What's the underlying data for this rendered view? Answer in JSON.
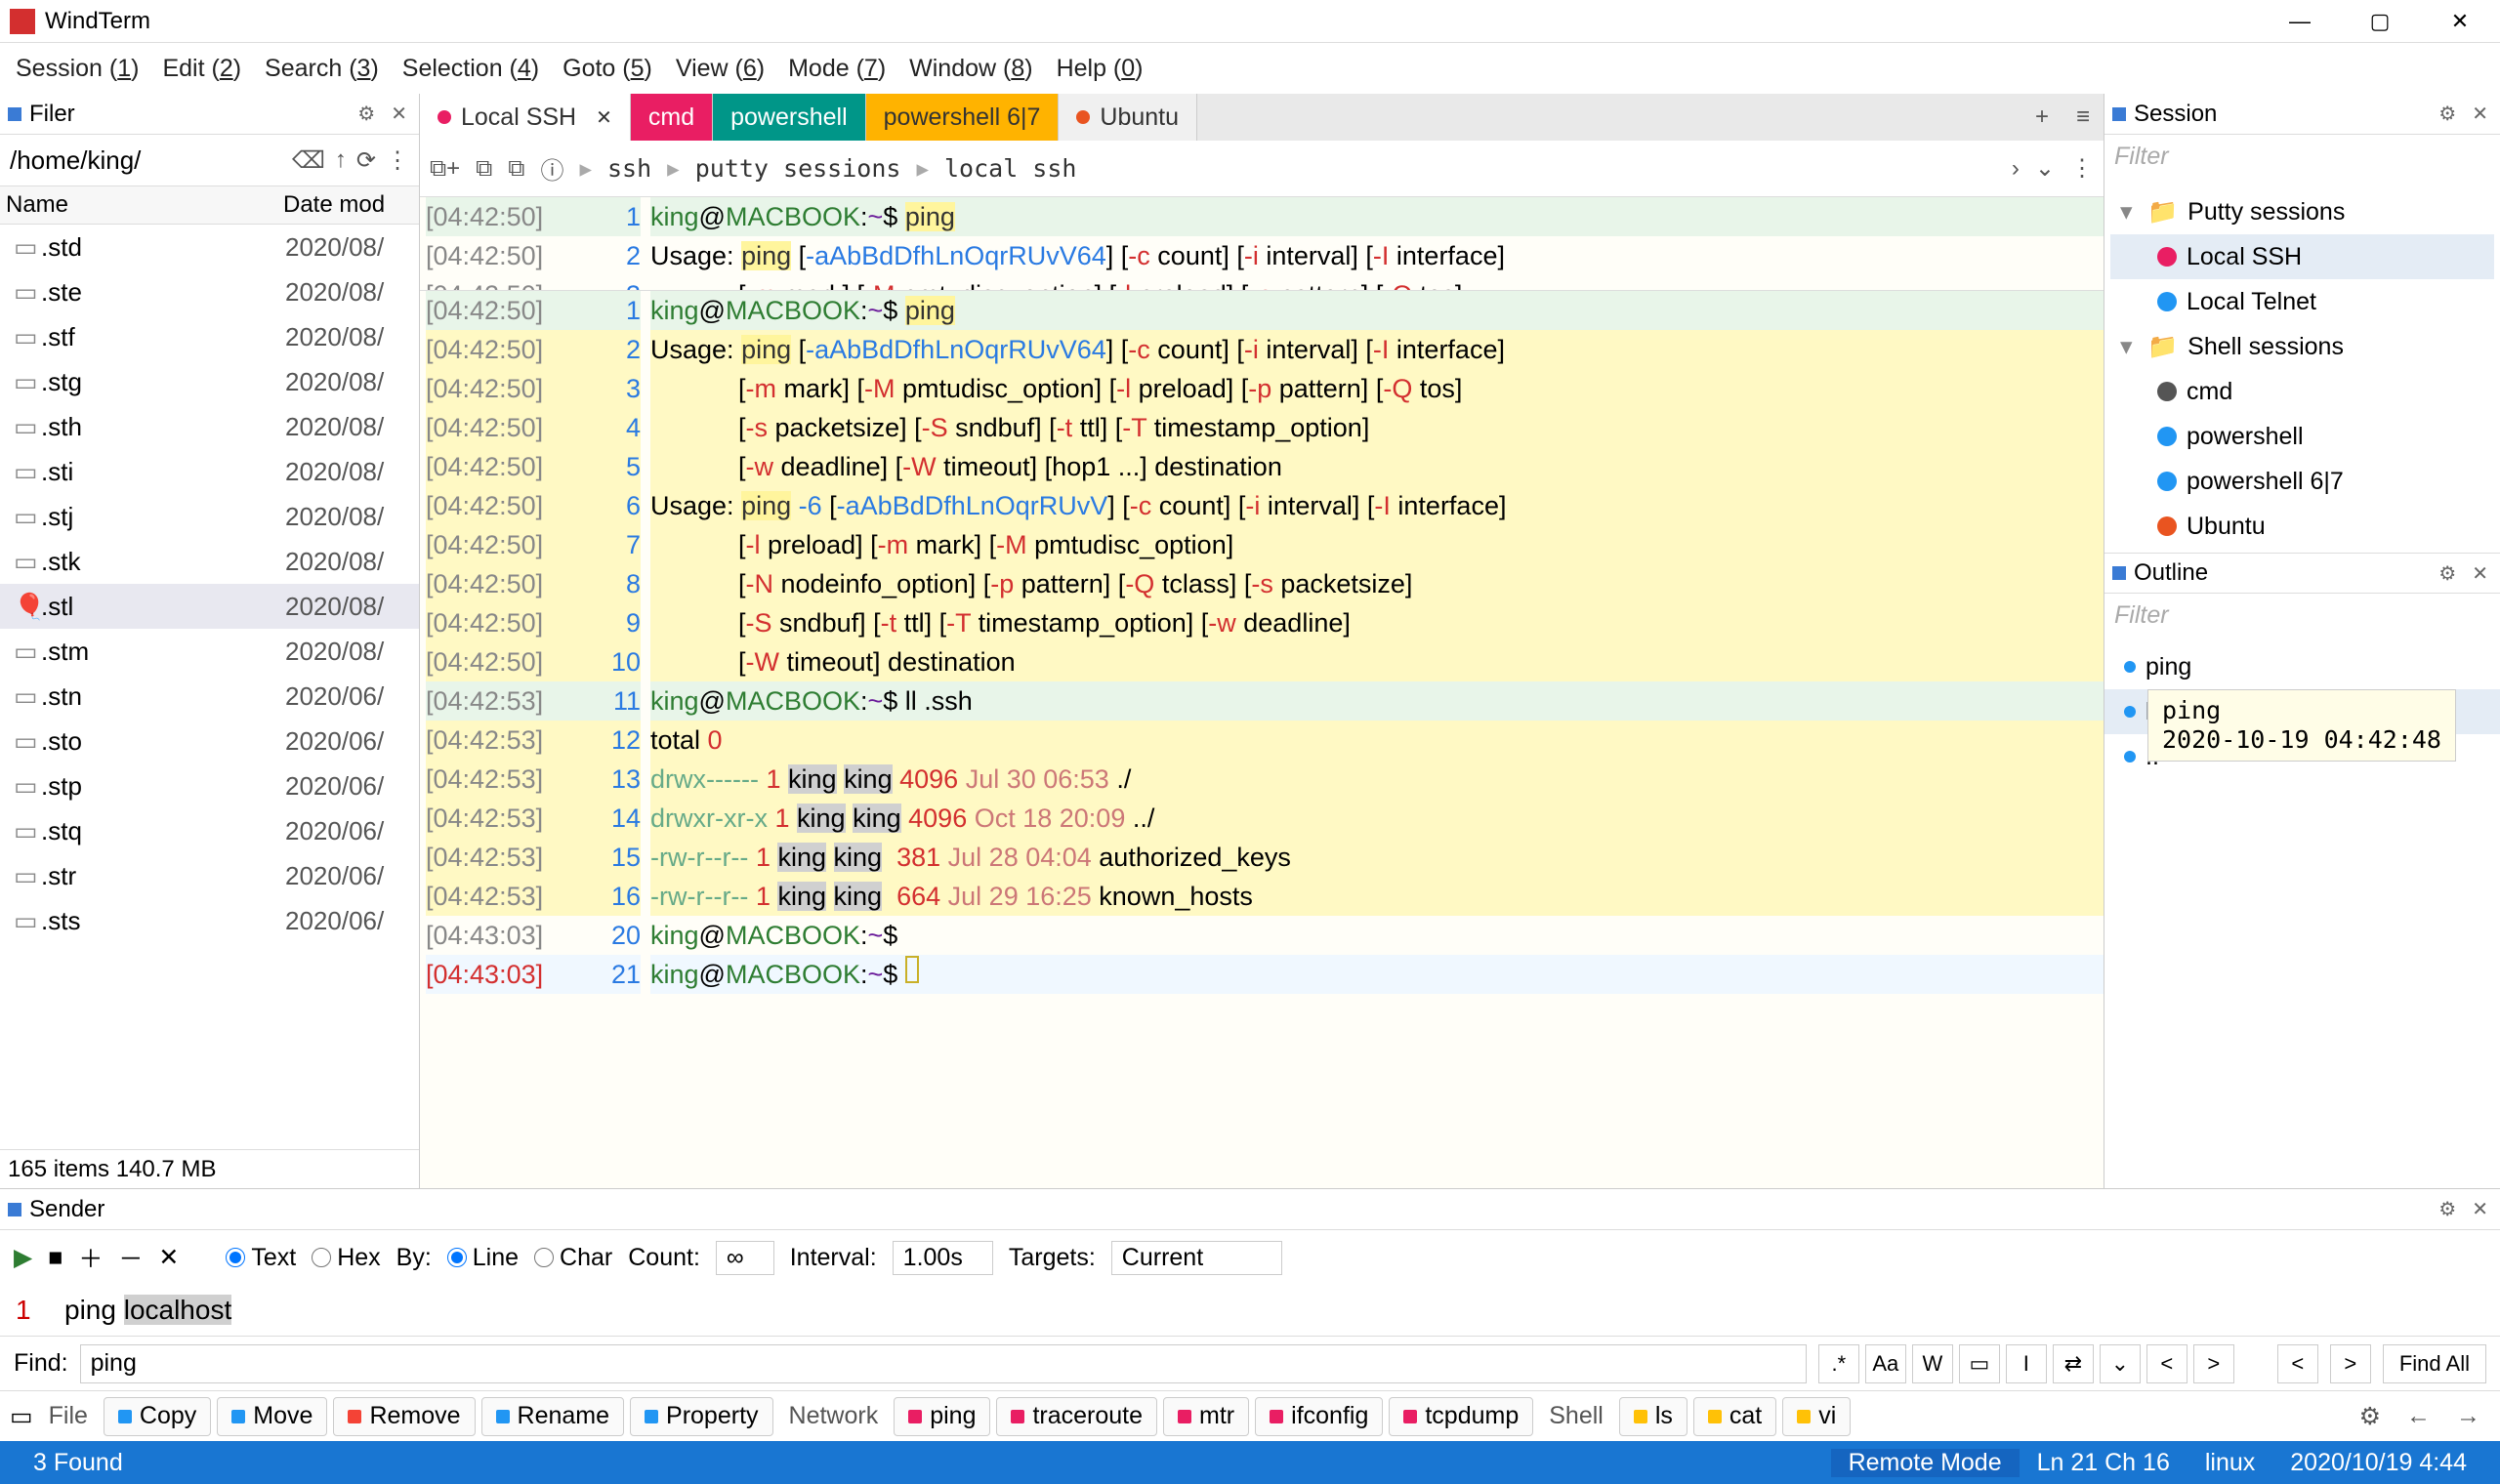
{
  "app": {
    "title": "WindTerm"
  },
  "window": {
    "min": "—",
    "max": "▢",
    "close": "✕"
  },
  "menu": [
    {
      "l": "Session",
      "k": "1"
    },
    {
      "l": "Edit",
      "k": "2"
    },
    {
      "l": "Search",
      "k": "3"
    },
    {
      "l": "Selection",
      "k": "4"
    },
    {
      "l": "Goto",
      "k": "5"
    },
    {
      "l": "View",
      "k": "6"
    },
    {
      "l": "Mode",
      "k": "7"
    },
    {
      "l": "Window",
      "k": "8"
    },
    {
      "l": "Help",
      "k": "0"
    }
  ],
  "filer": {
    "title": "Filer",
    "path": "/home/king/",
    "cols": {
      "name": "Name",
      "date": "Date mod"
    },
    "rows": [
      {
        "ic": "▭",
        "n": ".std",
        "d": "2020/08/"
      },
      {
        "ic": "▭",
        "n": ".ste",
        "d": "2020/08/"
      },
      {
        "ic": "▭",
        "n": ".stf",
        "d": "2020/08/"
      },
      {
        "ic": "▭",
        "n": ".stg",
        "d": "2020/08/"
      },
      {
        "ic": "▭",
        "n": ".sth",
        "d": "2020/08/"
      },
      {
        "ic": "▭",
        "n": ".sti",
        "d": "2020/08/"
      },
      {
        "ic": "▭",
        "n": ".stj",
        "d": "2020/08/"
      },
      {
        "ic": "▭",
        "n": ".stk",
        "d": "2020/08/"
      },
      {
        "ic": "🎈",
        "n": ".stl",
        "d": "2020/08/",
        "sel": true
      },
      {
        "ic": "▭",
        "n": ".stm",
        "d": "2020/08/"
      },
      {
        "ic": "▭",
        "n": ".stn",
        "d": "2020/06/"
      },
      {
        "ic": "▭",
        "n": ".sto",
        "d": "2020/06/"
      },
      {
        "ic": "▭",
        "n": ".stp",
        "d": "2020/06/"
      },
      {
        "ic": "▭",
        "n": ".stq",
        "d": "2020/06/"
      },
      {
        "ic": "▭",
        "n": ".str",
        "d": "2020/06/"
      },
      {
        "ic": "▭",
        "n": ".sts",
        "d": "2020/06/"
      }
    ],
    "status": "165 items 140.7 MB"
  },
  "tabs": [
    {
      "label": "Local SSH",
      "cls": "local",
      "dot": "#e91e63",
      "close": true
    },
    {
      "label": "cmd",
      "cls": "cmd"
    },
    {
      "label": "powershell",
      "cls": "ps"
    },
    {
      "label": "powershell 6|7",
      "cls": "ps6"
    },
    {
      "label": "Ubuntu",
      "cls": "ub",
      "dot": "#E95420"
    }
  ],
  "crumbs": [
    "ssh",
    "putty sessions",
    "local ssh"
  ],
  "term": {
    "lines": [
      {
        "t": "[04:42:50]",
        "n": "1",
        "cls": "hl-green",
        "html": "<span class='prompt-u'>king</span>@<span class='prompt-h'>MACBOOK</span>:<span class='prompt-d'>~</span>$ <span class='hl-ping'>ping</span>"
      },
      {
        "t": "[04:42:50]",
        "n": "2",
        "cls": "hl-row",
        "html": "Usage: <span class='hl-ping'>ping</span> [<span class='flag'>-aAbBdDfhLnOqrRUvV64</span>] [<span class='flagc'>-c</span> count] [<span class='flagc'>-i</span> interval] [<span class='flagc'>-I</span> interface]"
      },
      {
        "t": "[04:42:50]",
        "n": "3",
        "cls": "hl-row",
        "html": "            [<span class='flagc'>-m</span> mark] [<span class='flagc'>-M</span> pmtudisc_option] [<span class='flagc'>-l</span> preload] [<span class='flagc'>-p</span> pattern] [<span class='flagc'>-Q</span> tos]"
      },
      {
        "t": "[04:42:50]",
        "n": "4",
        "cls": "hl-row",
        "html": "            [<span class='flagc'>-s</span> packetsize] [<span class='flagc'>-S</span> sndbuf] [<span class='flagc'>-t</span> ttl] [<span class='flagc'>-T</span> timestamp_option]"
      },
      {
        "t": "[04:42:50]",
        "n": "5",
        "cls": "hl-row",
        "html": "            [<span class='flagc'>-w</span> deadline] [<span class='flagc'>-W</span> timeout] [hop1 ...] destination"
      },
      {
        "t": "[04:42:50]",
        "n": "6",
        "cls": "hl-row",
        "html": "Usage: <span class='hl-ping'>ping</span> <span class='flag'>-6</span> [<span class='flag'>-aAbBdDfhLnOqrRUvV</span>] [<span class='flagc'>-c</span> count] [<span class='flagc'>-i</span> interval] [<span class='flagc'>-I</span> interface]"
      },
      {
        "t": "[04:42:50]",
        "n": "7",
        "cls": "hl-row",
        "html": "            [<span class='flagc'>-l</span> preload] [<span class='flagc'>-m</span> mark] [<span class='flagc'>-M</span> pmtudisc_option]"
      },
      {
        "t": "[04:42:50]",
        "n": "8",
        "cls": "hl-row",
        "html": "            [<span class='flagc'>-N</span> nodeinfo_option] [<span class='flagc'>-p</span> pattern] [<span class='flagc'>-Q</span> tclass] [<span class='flagc'>-s</span> packetsize]"
      },
      {
        "t": "[04:42:50]",
        "n": "9",
        "cls": "hl-row",
        "html": "            [<span class='flagc'>-S</span> sndbuf] [<span class='flagc'>-t</span> ttl] [<span class='flagc'>-T</span> timestamp_option] [<span class='flagc'>-w</span> deadline]"
      },
      {
        "t": "[04:42:50]",
        "n": "10",
        "cls": "hl-row",
        "html": "            [<span class='flagc'>-W</span> timeout] destination"
      },
      {
        "t": "[04:42:53]",
        "n": "11",
        "cls": "hl-green",
        "html": "<span class='prompt-u'>king</span>@<span class='prompt-h'>MACBOOK</span>:<span class='prompt-d'>~</span>$ ll .ssh"
      },
      {
        "t": "[04:42:53]",
        "n": "12",
        "cls": "hl-row",
        "html": "total <span class='num'>0</span>"
      },
      {
        "t": "[04:42:53]",
        "n": "13",
        "cls": "hl-row",
        "html": "<span class='perm'>drwx------</span> <span class='num'>1</span> <span class='sel-bg'>king</span> <span class='sel-bg'>king</span> <span class='num'>4096</span> <span class='date'>Jul 30 06:53</span> ./"
      },
      {
        "t": "[04:42:53]",
        "n": "14",
        "cls": "hl-row",
        "html": "<span class='perm'>drwxr-xr-x</span> <span class='num'>1</span> <span class='sel-bg'>king</span> <span class='sel-bg'>king</span> <span class='num'>4096</span> <span class='date'>Oct 18 20:09</span> ../"
      },
      {
        "t": "[04:42:53]",
        "n": "15",
        "cls": "hl-row",
        "html": "<span class='perm'>-rw-r--r--</span> <span class='num'>1</span> <span class='sel-bg'>king</span> <span class='sel-bg'>king</span>  <span class='num'>381</span> <span class='date'>Jul 28 04:04</span> authorized_keys"
      },
      {
        "t": "[04:42:53]",
        "n": "16",
        "cls": "hl-row",
        "html": "<span class='perm'>-rw-r--r--</span> <span class='num'>1</span> <span class='sel-bg'>king</span> <span class='sel-bg'>king</span>  <span class='num'>664</span> <span class='date'>Jul 29 16:25</span> known_hosts"
      },
      {
        "t": "[04:43:03]",
        "n": "20",
        "cls": "",
        "html": "<span class='prompt-u'>king</span>@<span class='prompt-h'>MACBOOK</span>:<span class='prompt-d'>~</span>$"
      },
      {
        "t": "[04:43:03]",
        "n": "21",
        "cls": "curRow",
        "tstyle": "color:#d32f2f",
        "html": "<span class='prompt-u'>king</span>@<span class='prompt-h'>MACBOOK</span>:<span class='prompt-d'>~</span>$ <span class='cursor'></span>"
      }
    ],
    "toplines": [
      {
        "t": "[04:42:50]",
        "n": "1",
        "cls": "hl-green",
        "html": "<span class='prompt-u'>king</span>@<span class='prompt-h'>MACBOOK</span>:<span class='prompt-d'>~</span>$ <span class='hl-ping'>ping</span>"
      },
      {
        "t": "[04:42:50]",
        "n": "2",
        "cls": "",
        "html": "Usage: <span class='hl-ping'>ping</span> [<span class='flag'>-aAbBdDfhLnOqrRUvV64</span>] [<span class='flagc'>-c</span> count] [<span class='flagc'>-i</span> interval] [<span class='flagc'>-I</span> interface]"
      },
      {
        "t": "[04:42:50]",
        "n": "3",
        "cls": "",
        "html": "            [<span class='flagc'>-m</span> mark] [<span class='flagc'>-M</span> pmtudisc_option] [<span class='flagc'>-l</span> preload] [<span class='flagc'>-p</span> pattern] [<span class='flagc'>-Q</span> tos]"
      }
    ]
  },
  "session": {
    "title": "Session",
    "filter": "Filter",
    "g1": "Putty sessions",
    "g2": "Shell sessions",
    "items1": [
      {
        "l": "Local SSH",
        "c": "#e91e63",
        "sel": true
      },
      {
        "l": "Local Telnet",
        "c": "#2196f3"
      }
    ],
    "items2": [
      {
        "l": "cmd",
        "c": "#555"
      },
      {
        "l": "powershell",
        "c": "#2196f3"
      },
      {
        "l": "powershell 6|7",
        "c": "#2196f3"
      },
      {
        "l": "Ubuntu",
        "c": "#E95420"
      }
    ]
  },
  "outline": {
    "title": "Outline",
    "filter": "Filter",
    "items": [
      {
        "l": "ping",
        "c": "#2196f3"
      },
      {
        "l": "ll",
        "c": "#2196f3",
        "sel": true
      },
      {
        "l": "..",
        "c": "#2196f3"
      }
    ],
    "tooltip": {
      "l1": "ping",
      "l2": "2020-10-19 04:42:48"
    }
  },
  "sender": {
    "title": "Sender",
    "text_lbl": "Text",
    "hex_lbl": "Hex",
    "by": "By:",
    "line": "Line",
    "char": "Char",
    "count": "Count:",
    "count_v": "∞",
    "interval": "Interval:",
    "interval_v": "1.00s",
    "targets": "Targets:",
    "target_v": "Current",
    "content": "ping localhost",
    "content_hl": "localhost"
  },
  "find": {
    "label": "Find:",
    "value": "ping",
    "btns": [
      ".*",
      "Aa",
      "W",
      "▭",
      "I",
      "⇄",
      "⌄",
      "<",
      ">"
    ],
    "findall": "Find All"
  },
  "quickbar": {
    "file": "File",
    "file_items": [
      {
        "l": "Copy",
        "c": "#2196f3"
      },
      {
        "l": "Move",
        "c": "#2196f3"
      },
      {
        "l": "Remove",
        "c": "#f44336"
      },
      {
        "l": "Rename",
        "c": "#2196f3"
      },
      {
        "l": "Property",
        "c": "#2196f3"
      }
    ],
    "net": "Network",
    "net_items": [
      {
        "l": "ping",
        "c": "#e91e63"
      },
      {
        "l": "traceroute",
        "c": "#e91e63"
      },
      {
        "l": "mtr",
        "c": "#e91e63"
      },
      {
        "l": "ifconfig",
        "c": "#e91e63"
      },
      {
        "l": "tcpdump",
        "c": "#e91e63"
      }
    ],
    "shell": "Shell",
    "shell_items": [
      {
        "l": "ls",
        "c": "#ffc107"
      },
      {
        "l": "cat",
        "c": "#ffc107"
      },
      {
        "l": "vi",
        "c": "#ffc107"
      }
    ]
  },
  "status": {
    "found": "3 Found",
    "mode": "Remote Mode",
    "pos": "Ln 21 Ch 16",
    "os": "linux",
    "time": "2020/10/19 4:44"
  }
}
